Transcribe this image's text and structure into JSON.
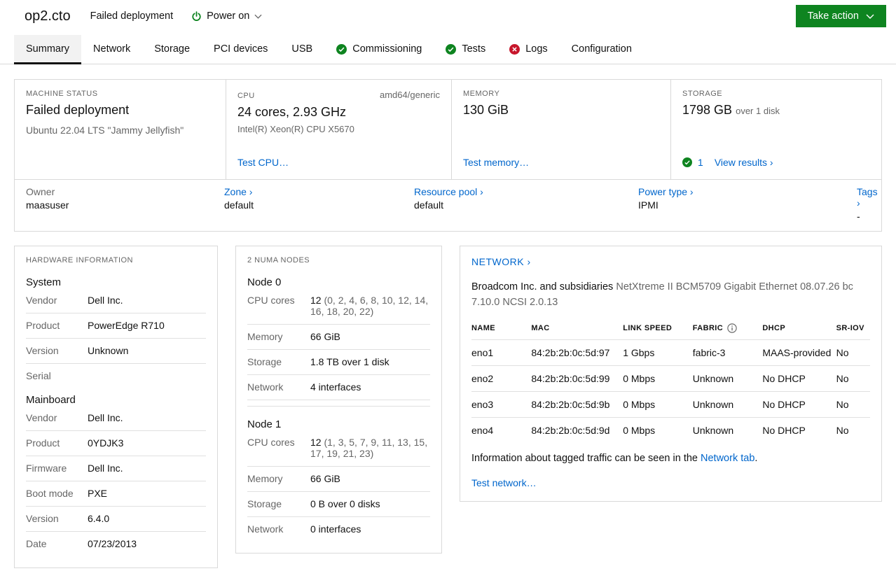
{
  "colors": {
    "accent_green": "#0e8420",
    "link_blue": "#0066cc",
    "error_red": "#c7162b"
  },
  "header": {
    "title": "op2.cto",
    "status": "Failed deployment",
    "power_label": "Power on",
    "take_action_label": "Take action"
  },
  "tabs": [
    {
      "label": "Summary"
    },
    {
      "label": "Network"
    },
    {
      "label": "Storage"
    },
    {
      "label": "PCI devices"
    },
    {
      "label": "USB"
    },
    {
      "label": "Commissioning",
      "status": "success"
    },
    {
      "label": "Tests",
      "status": "success"
    },
    {
      "label": "Logs",
      "status": "error"
    },
    {
      "label": "Configuration"
    }
  ],
  "overview": {
    "machine_status": {
      "label": "MACHINE STATUS",
      "value": "Failed deployment",
      "os": "Ubuntu 22.04 LTS \"Jammy Jellyfish\""
    },
    "cpu": {
      "label": "CPU",
      "arch": "amd64/generic",
      "value": "24 cores, 2.93 GHz",
      "model": "Intel(R) Xeon(R) CPU X5670",
      "test_link": "Test CPU…"
    },
    "memory": {
      "label": "MEMORY",
      "value": "130 GiB",
      "test_link": "Test memory…"
    },
    "storage": {
      "label": "STORAGE",
      "value": "1798 GB",
      "suffix": "over 1 disk",
      "result_count": "1",
      "results_link": "View results ›"
    },
    "meta": [
      {
        "label": "Owner",
        "value": "maasuser"
      },
      {
        "label": "Zone ›",
        "value": "default"
      },
      {
        "label": "Resource pool ›",
        "value": "default"
      },
      {
        "label": "Power type ›",
        "value": "IPMI"
      },
      {
        "label": "Tags ›",
        "value": "-"
      }
    ]
  },
  "hardware": {
    "heading": "HARDWARE INFORMATION",
    "sections": [
      {
        "title": "System",
        "rows": [
          {
            "label": "Vendor",
            "value": "Dell Inc."
          },
          {
            "label": "Product",
            "value": "PowerEdge R710"
          },
          {
            "label": "Version",
            "value": "Unknown"
          },
          {
            "label": "Serial",
            "value": ""
          }
        ]
      },
      {
        "title": "Mainboard",
        "rows": [
          {
            "label": "Vendor",
            "value": "Dell Inc."
          },
          {
            "label": "Product",
            "value": "0YDJK3"
          },
          {
            "label": "Firmware",
            "value": "Dell Inc."
          },
          {
            "label": "Boot mode",
            "value": "PXE"
          },
          {
            "label": "Version",
            "value": "6.4.0"
          },
          {
            "label": "Date",
            "value": "07/23/2013"
          }
        ]
      }
    ]
  },
  "numa": {
    "heading": "2 NUMA NODES",
    "nodes": [
      {
        "title": "Node 0",
        "cores_label": "CPU cores",
        "cores_count": "12",
        "cores_list": "(0, 2, 4, 6, 8, 10, 12, 14, 16, 18, 20, 22)",
        "memory_label": "Memory",
        "memory": "66 GiB",
        "storage_label": "Storage",
        "storage": "1.8 TB over 1 disk",
        "network_label": "Network",
        "network": "4 interfaces"
      },
      {
        "title": "Node 1",
        "cores_label": "CPU cores",
        "cores_count": "12",
        "cores_list": "(1, 3, 5, 7, 9, 11, 13, 15, 17, 19, 21, 23)",
        "memory_label": "Memory",
        "memory": "66 GiB",
        "storage_label": "Storage",
        "storage": "0 B over 0 disks",
        "network_label": "Network",
        "network": "0 interfaces"
      }
    ]
  },
  "network": {
    "heading": "NETWORK ›",
    "vendor": "Broadcom Inc. and subsidiaries",
    "model": "NetXtreme II BCM5709 Gigabit Ethernet",
    "firmware": "08.07.26 bc 7.10.0 NCSI 2.0.13",
    "columns": {
      "name": "NAME",
      "mac": "MAC",
      "link_speed": "LINK SPEED",
      "fabric": "FABRIC",
      "dhcp": "DHCP",
      "sriov": "SR-IOV"
    },
    "rows": [
      {
        "name": "eno1",
        "mac": "84:2b:2b:0c:5d:97",
        "link_speed": "1 Gbps",
        "fabric": "fabric-3",
        "dhcp": "MAAS-provided",
        "sriov": "No"
      },
      {
        "name": "eno2",
        "mac": "84:2b:2b:0c:5d:99",
        "link_speed": "0 Mbps",
        "fabric": "Unknown",
        "dhcp": "No DHCP",
        "sriov": "No"
      },
      {
        "name": "eno3",
        "mac": "84:2b:2b:0c:5d:9b",
        "link_speed": "0 Mbps",
        "fabric": "Unknown",
        "dhcp": "No DHCP",
        "sriov": "No"
      },
      {
        "name": "eno4",
        "mac": "84:2b:2b:0c:5d:9d",
        "link_speed": "0 Mbps",
        "fabric": "Unknown",
        "dhcp": "No DHCP",
        "sriov": "No"
      }
    ],
    "info_before": "Information about tagged traffic can be seen in the ",
    "info_link": "Network tab",
    "info_after": ".",
    "test_link": "Test network…"
  }
}
